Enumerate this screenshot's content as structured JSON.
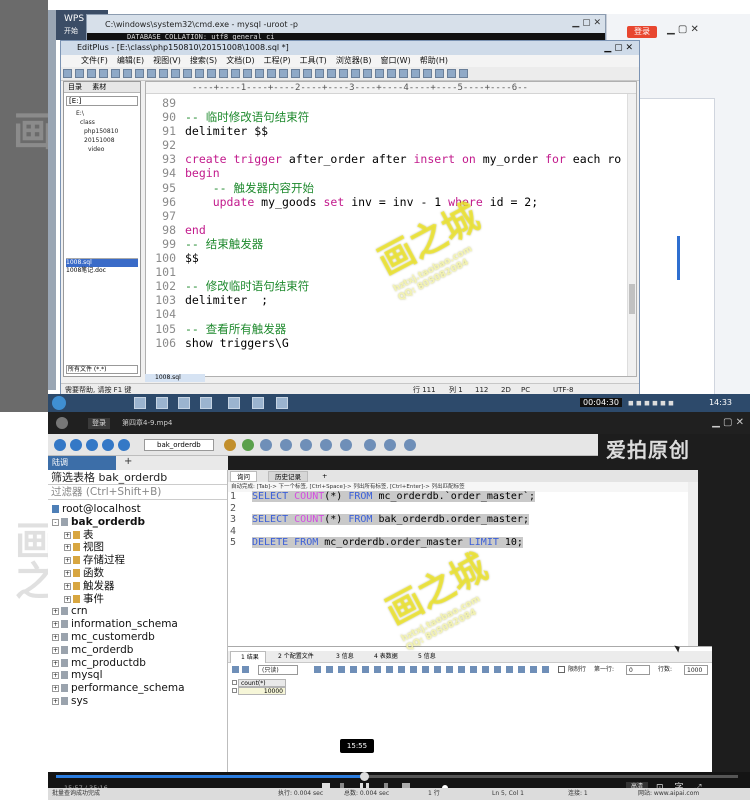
{
  "top": {
    "wps_title": "WPS",
    "wps_tab": "开始",
    "cmd_title": "C:\\windows\\system32\\cmd.exe - mysql  -uroot -p",
    "cmd_line": "DATABASE_COLLATION: utf8_general_ci",
    "login_button": "登录",
    "editplus": {
      "title": "EditPlus - [E:\\class\\php150810\\20151008\\1008.sql *]",
      "menu": [
        "文件(F)",
        "编辑(E)",
        "视图(V)",
        "搜索(S)",
        "文档(D)",
        "工程(P)",
        "工具(T)",
        "浏览器(B)",
        "窗口(W)",
        "帮助(H)"
      ],
      "side_tabs": [
        "目录",
        "素材"
      ],
      "drive": "[E:]",
      "tree": [
        "E:\\",
        "class",
        "php150810",
        "20151008",
        "video"
      ],
      "files": [
        "1008.sql",
        "1008笔记.doc"
      ],
      "file_filter": "所有文件 (*.*)",
      "doc_tab": "1008.sql",
      "ruler": "----+----1----+----2----+----3----+----4----+----5----+----6--",
      "code": [
        {
          "n": "89",
          "parts": []
        },
        {
          "n": "90",
          "parts": [
            {
              "t": "-- 临时修改语句结束符",
              "c": "cm"
            }
          ]
        },
        {
          "n": "91",
          "parts": [
            {
              "t": "delimiter $$",
              "c": ""
            }
          ]
        },
        {
          "n": "92",
          "parts": []
        },
        {
          "n": "93",
          "parts": [
            {
              "t": "create trigger",
              "c": "kw"
            },
            {
              "t": " after_order after ",
              "c": ""
            },
            {
              "t": "insert on",
              "c": "kw"
            },
            {
              "t": " my_order ",
              "c": ""
            },
            {
              "t": "for",
              "c": "kw"
            },
            {
              "t": " each ro",
              "c": ""
            }
          ]
        },
        {
          "n": "94",
          "parts": [
            {
              "t": "begin",
              "c": "kw"
            }
          ]
        },
        {
          "n": "95",
          "parts": [
            {
              "t": "    -- 触发器内容开始",
              "c": "cm"
            }
          ]
        },
        {
          "n": "96",
          "parts": [
            {
              "t": "    ",
              "c": ""
            },
            {
              "t": "update",
              "c": "kw"
            },
            {
              "t": " my_goods ",
              "c": ""
            },
            {
              "t": "set",
              "c": "kw"
            },
            {
              "t": " inv = inv - 1 ",
              "c": ""
            },
            {
              "t": "where",
              "c": "kw"
            },
            {
              "t": " id = 2;",
              "c": ""
            }
          ]
        },
        {
          "n": "97",
          "parts": []
        },
        {
          "n": "98",
          "parts": [
            {
              "t": "end",
              "c": "kw"
            }
          ]
        },
        {
          "n": "99",
          "parts": [
            {
              "t": "-- 结束触发器",
              "c": "cm"
            }
          ]
        },
        {
          "n": "100",
          "parts": [
            {
              "t": "$$",
              "c": ""
            }
          ]
        },
        {
          "n": "101",
          "parts": []
        },
        {
          "n": "102",
          "parts": [
            {
              "t": "-- 修改临时语句结束符",
              "c": "cm"
            }
          ]
        },
        {
          "n": "103",
          "parts": [
            {
              "t": "delimiter  ;",
              "c": ""
            }
          ]
        },
        {
          "n": "104",
          "parts": []
        },
        {
          "n": "105",
          "parts": [
            {
              "t": "-- 查看所有触发器",
              "c": "cm"
            }
          ]
        },
        {
          "n": "106",
          "parts": [
            {
              "t": "show triggers\\G",
              "c": ""
            }
          ]
        }
      ],
      "status": {
        "help": "需要帮助, 请按 F1 键",
        "row": "行 111",
        "col": "列 1",
        "chars": "112",
        "mode": "2D",
        "os": "PC",
        "encoding": "UTF-8"
      }
    },
    "taskbar": {
      "time_badge": "00:04:30",
      "clock": "14:33"
    }
  },
  "player": {
    "login": "登录",
    "file": "第四章4-9.mp4",
    "brand": "爱拍原创",
    "db_select": "bak_orderdb",
    "conn_tab": "陆调",
    "filter_table": "筛选表格 bak_orderdb",
    "filter_hint": "过滤器 (Ctrl+Shift+B)",
    "tree": [
      {
        "label": "root@localhost",
        "level": 0,
        "icon": "srv",
        "bold": false,
        "exp": ""
      },
      {
        "label": "bak_orderdb",
        "level": 0,
        "icon": "db",
        "bold": true,
        "exp": "-"
      },
      {
        "label": "表",
        "level": 1,
        "icon": "",
        "bold": false,
        "exp": "+"
      },
      {
        "label": "视图",
        "level": 1,
        "icon": "",
        "bold": false,
        "exp": "+"
      },
      {
        "label": "存储过程",
        "level": 1,
        "icon": "",
        "bold": false,
        "exp": "+"
      },
      {
        "label": "函数",
        "level": 1,
        "icon": "",
        "bold": false,
        "exp": "+"
      },
      {
        "label": "触发器",
        "level": 1,
        "icon": "",
        "bold": false,
        "exp": "+"
      },
      {
        "label": "事件",
        "level": 1,
        "icon": "",
        "bold": false,
        "exp": "+"
      },
      {
        "label": "crn",
        "level": 0,
        "icon": "db",
        "bold": false,
        "exp": "+"
      },
      {
        "label": "information_schema",
        "level": 0,
        "icon": "db",
        "bold": false,
        "exp": "+"
      },
      {
        "label": "mc_customerdb",
        "level": 0,
        "icon": "db",
        "bold": false,
        "exp": "+"
      },
      {
        "label": "mc_orderdb",
        "level": 0,
        "icon": "db",
        "bold": false,
        "exp": "+"
      },
      {
        "label": "mc_productdb",
        "level": 0,
        "icon": "db",
        "bold": false,
        "exp": "+"
      },
      {
        "label": "mysql",
        "level": 0,
        "icon": "db",
        "bold": false,
        "exp": "+"
      },
      {
        "label": "performance_schema",
        "level": 0,
        "icon": "db",
        "bold": false,
        "exp": "+"
      },
      {
        "label": "sys",
        "level": 0,
        "icon": "db",
        "bold": false,
        "exp": "+"
      }
    ],
    "query_tabs": [
      "询问",
      "历史记录"
    ],
    "query_hint": "自动完成: [Tab]-> 下一个标签, [Ctrl+Space]-> 列出所有标签, [Ctrl+Enter]-> 列出匹配标签",
    "query": [
      {
        "n": "1",
        "hl": true,
        "parts": [
          {
            "t": "SELECT",
            "c": "k"
          },
          {
            "t": " ",
            "c": ""
          },
          {
            "t": "COUNT",
            "c": "f"
          },
          {
            "t": "(*) ",
            "c": ""
          },
          {
            "t": "FROM",
            "c": "k"
          },
          {
            "t": " mc_orderdb.`order_master`;",
            "c": ""
          }
        ]
      },
      {
        "n": "2",
        "hl": false,
        "parts": []
      },
      {
        "n": "3",
        "hl": true,
        "parts": [
          {
            "t": "SELECT",
            "c": "k"
          },
          {
            "t": " ",
            "c": ""
          },
          {
            "t": "COUNT",
            "c": "f"
          },
          {
            "t": "(*) ",
            "c": ""
          },
          {
            "t": "FROM",
            "c": "k"
          },
          {
            "t": " bak_orderdb.order_master;",
            "c": ""
          }
        ]
      },
      {
        "n": "4",
        "hl": false,
        "parts": []
      },
      {
        "n": "5",
        "hl": true,
        "parts": [
          {
            "t": "DELETE",
            "c": "k"
          },
          {
            "t": " ",
            "c": ""
          },
          {
            "t": "FROM",
            "c": "k"
          },
          {
            "t": " mc_orderdb.order_master ",
            "c": ""
          },
          {
            "t": "LIMIT",
            "c": "k"
          },
          {
            "t": " 10;",
            "c": ""
          }
        ]
      }
    ],
    "result_tabs": [
      "1 结果",
      "2 个配置文件",
      "3 信息",
      "4 表数据",
      "5 信息"
    ],
    "result_mode": "(只读)",
    "first_row_label": "第一行:",
    "first_row": "0",
    "rows_label": "行数:",
    "rows": "1000",
    "limit_label": "限制行",
    "result_col": "count(*)",
    "result_val": "10000",
    "tooltip_time": "15:55",
    "elapsed": "15:57 / 35:16",
    "quality": "高清",
    "status_left": "批量查询成功完成",
    "status_exec": "执行: 0.004 sec",
    "status_total": "总数: 0.004 sec",
    "status_rows": "1 行",
    "status_pos": "Ln 5, Col 1",
    "status_conn": "连接: 1",
    "status_right": "网站: www.aipai.com"
  },
  "watermarks": {
    "title": "画之城",
    "url": "hztxj.taobao.com",
    "qq": "QQ: 805082084"
  }
}
